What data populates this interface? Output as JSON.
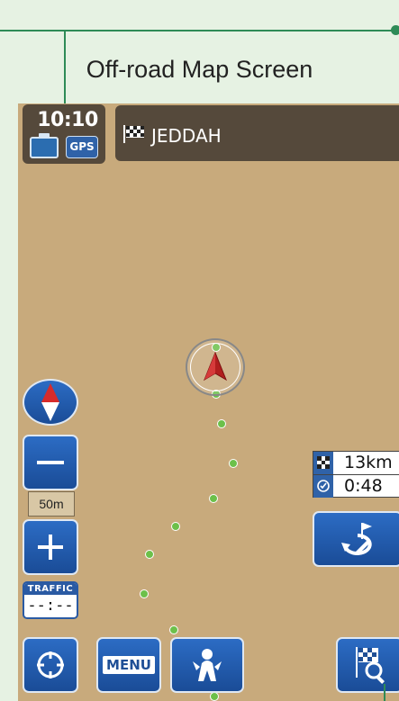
{
  "caption": "Off-road Map Screen",
  "status": {
    "time": "10:10",
    "gps_label": "GPS"
  },
  "destination": {
    "name": "JEDDAH"
  },
  "scale": {
    "label": "50m"
  },
  "traffic": {
    "header": "TRAFFIC",
    "value": "--:--"
  },
  "info_panel": {
    "distance": "13km",
    "time": "0:48"
  },
  "buttons": {
    "menu_label": "MENU"
  },
  "icons": {
    "compass": "compass-icon",
    "zoom_out": "minus-icon",
    "zoom_in": "plus-icon",
    "locate": "crosshair-icon",
    "route": "person-route-icon",
    "reroute": "reroute-icon",
    "destination_search": "flag-search-icon",
    "flag": "checkered-flag-icon",
    "clock": "clock-icon"
  },
  "colors": {
    "map_background": "#c8aa7c",
    "bar_background": "#55493b",
    "button_blue": "#2c6cc4",
    "track_dot": "#6cc04a",
    "annotation_green": "#2e8b57",
    "vehicle_arrow": "#b01e1e"
  }
}
